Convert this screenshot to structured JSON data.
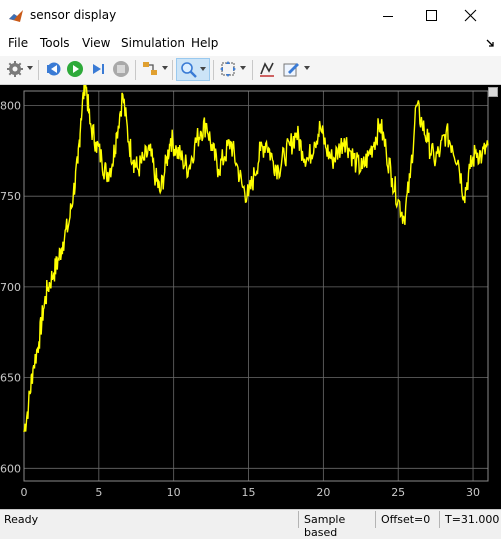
{
  "window": {
    "title": "sensor display",
    "controls": [
      "minimize-icon",
      "maximize-icon",
      "close-icon"
    ]
  },
  "menu": [
    "File",
    "Tools",
    "View",
    "Simulation",
    "Help"
  ],
  "toolbar": {
    "icons": [
      "gear-icon",
      "step-back-icon",
      "run-icon",
      "step-forward-icon",
      "stop-icon",
      "highlight-icon",
      "zoom-icon",
      "autoscale-icon",
      "cursor-measure-icon",
      "edit-icon"
    ]
  },
  "colors": {
    "signal": "#ffff00",
    "background": "#000000",
    "grid": "#6a6a6a",
    "axis_text": "#c8c8c8"
  },
  "chart_data": {
    "type": "line",
    "title": "",
    "xlabel": "",
    "ylabel": "",
    "xlim": [
      0,
      31
    ],
    "ylim": [
      593,
      808
    ],
    "xticks": [
      0,
      5,
      10,
      15,
      20,
      25,
      30
    ],
    "yticks": [
      600,
      650,
      700,
      750,
      800
    ],
    "grid": true,
    "series": [
      {
        "name": "",
        "color": "#ffff00",
        "x": [
          0,
          0.3,
          0.6,
          1.0,
          1.3,
          1.6,
          2.0,
          2.3,
          2.6,
          3.0,
          3.3,
          3.6,
          3.8,
          4.1,
          4.4,
          4.8,
          5.2,
          5.5,
          5.9,
          6.2,
          6.6,
          7.0,
          7.3,
          7.6,
          8.0,
          8.4,
          8.8,
          9.1,
          9.5,
          9.8,
          10.2,
          10.6,
          11.0,
          11.4,
          11.8,
          12.2,
          12.6,
          13.0,
          13.4,
          13.8,
          14.2,
          14.6,
          15.0,
          15.4,
          15.8,
          16.2,
          16.6,
          17.0,
          17.4,
          17.8,
          18.2,
          18.6,
          19.0,
          19.4,
          19.8,
          20.2,
          20.6,
          21.0,
          21.4,
          21.8,
          22.2,
          22.6,
          23.0,
          23.4,
          23.8,
          24.2,
          24.6,
          25.0,
          25.4,
          25.8,
          26.2,
          26.6,
          27.0,
          27.4,
          27.8,
          28.2,
          28.6,
          29.0,
          29.4,
          29.8,
          30.2,
          30.6,
          31.0
        ],
        "values": [
          620,
          635,
          655,
          670,
          688,
          700,
          708,
          715,
          725,
          735,
          752,
          768,
          793,
          815,
          790,
          780,
          770,
          762,
          768,
          785,
          806,
          780,
          770,
          765,
          770,
          775,
          760,
          752,
          768,
          782,
          775,
          770,
          765,
          778,
          786,
          790,
          775,
          765,
          772,
          780,
          768,
          755,
          750,
          762,
          775,
          780,
          770,
          765,
          772,
          778,
          785,
          775,
          770,
          780,
          788,
          776,
          770,
          775,
          782,
          775,
          768,
          765,
          772,
          780,
          790,
          775,
          760,
          748,
          738,
          760,
          800,
          790,
          780,
          770,
          775,
          785,
          778,
          770,
          750,
          765,
          775,
          772,
          778
        ]
      }
    ]
  },
  "status": {
    "ready": "Ready",
    "mode": "Sample based",
    "offset": "Offset=0",
    "time": "T=31.000"
  }
}
